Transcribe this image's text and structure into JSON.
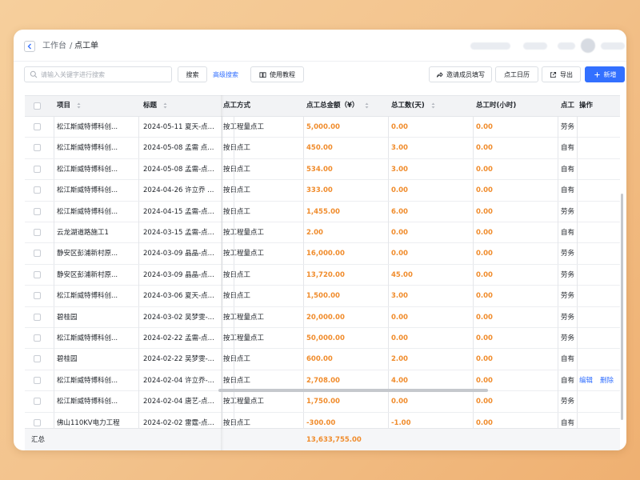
{
  "header": {
    "breadcrumb_root": "工作台",
    "breadcrumb_separator": "/",
    "breadcrumb_current": "点工单"
  },
  "toolbar": {
    "search_placeholder": "请输入关键字进行搜索",
    "search_button": "搜索",
    "advanced_search": "高级搜索",
    "tutorial_button": "使用教程",
    "invite_button": "邀请成员填写",
    "calendar_button": "点工日历",
    "export_button": "导出",
    "add_button": "新增"
  },
  "table": {
    "columns": {
      "project": "项目",
      "title": "标题",
      "method": "点工方式",
      "amount": "点工总金额（¥）",
      "days": "总工数(天)",
      "hours": "总工时(小时)",
      "type": "点工",
      "actions": "操作"
    },
    "rows": [
      {
        "project": "松江斯威特博科创...",
        "title": "2024-05-11 夏天-点...",
        "method": "按工程量点工",
        "amount": "5,000.00",
        "days": "0.00",
        "hours": "0.00",
        "type": "劳务"
      },
      {
        "project": "松江斯威特博科创...",
        "title": "2024-05-08 孟需 点...",
        "method": "按日点工",
        "amount": "450.00",
        "days": "3.00",
        "hours": "0.00",
        "type": "自有"
      },
      {
        "project": "松江斯威特博科创...",
        "title": "2024-05-08 孟需-点...",
        "method": "按日点工",
        "amount": "534.00",
        "days": "3.00",
        "hours": "0.00",
        "type": "自有"
      },
      {
        "project": "松江斯威特博科创...",
        "title": "2024-04-26 许立乔 ...",
        "method": "按日点工",
        "amount": "333.00",
        "days": "0.00",
        "hours": "0.00",
        "type": "自有"
      },
      {
        "project": "松江斯威特博科创...",
        "title": "2024-04-15 孟需-点...",
        "method": "按日点工",
        "amount": "1,455.00",
        "days": "6.00",
        "hours": "0.00",
        "type": "劳务"
      },
      {
        "project": "云龙湖道路施工1",
        "title": "2024-03-15 孟需-点...",
        "method": "按工程量点工",
        "amount": "2.00",
        "days": "0.00",
        "hours": "0.00",
        "type": "自有"
      },
      {
        "project": "静安区彭浦新村原...",
        "title": "2024-03-09 晶晶-点...",
        "method": "按工程量点工",
        "amount": "16,000.00",
        "days": "0.00",
        "hours": "0.00",
        "type": "劳务"
      },
      {
        "project": "静安区彭浦新村原...",
        "title": "2024-03-09 晶晶-点...",
        "method": "按日点工",
        "amount": "13,720.00",
        "days": "45.00",
        "hours": "0.00",
        "type": "劳务"
      },
      {
        "project": "松江斯威特博科创...",
        "title": "2024-03-06 夏天-点...",
        "method": "按日点工",
        "amount": "1,500.00",
        "days": "3.00",
        "hours": "0.00",
        "type": "劳务"
      },
      {
        "project": "碧桂园",
        "title": "2024-03-02 吴梦雯-...",
        "method": "按工程量点工",
        "amount": "20,000.00",
        "days": "0.00",
        "hours": "0.00",
        "type": "劳务"
      },
      {
        "project": "松江斯威特博科创...",
        "title": "2024-02-22 孟需-点...",
        "method": "按工程量点工",
        "amount": "50,000.00",
        "days": "0.00",
        "hours": "0.00",
        "type": "劳务"
      },
      {
        "project": "碧桂园",
        "title": "2024-02-22 吴梦雯-...",
        "method": "按日点工",
        "amount": "600.00",
        "days": "2.00",
        "hours": "0.00",
        "type": "自有"
      },
      {
        "project": "松江斯威特博科创...",
        "title": "2024-02-04 许立乔-...",
        "method": "按日点工",
        "amount": "2,708.00",
        "days": "4.00",
        "hours": "0.00",
        "type": "自有",
        "edit": "编辑",
        "delete": "删除"
      },
      {
        "project": "松江斯威特博科创...",
        "title": "2024-02-04 唐艺-点...",
        "method": "按工程量点工",
        "amount": "1,750.00",
        "days": "0.00",
        "hours": "0.00",
        "type": "劳务"
      },
      {
        "project": "佛山110KV电力工程",
        "title": "2024-02-02 雷霆-点...",
        "method": "按日点工",
        "amount": "-300.00",
        "days": "-1.00",
        "hours": "0.00",
        "type": "自有"
      }
    ],
    "summary": {
      "label": "汇总",
      "total_amount": "13,633,755.00"
    }
  },
  "colors": {
    "accent": "#3370ff",
    "amount": "#f08c2c",
    "background_gradient": "#f3c48e"
  }
}
